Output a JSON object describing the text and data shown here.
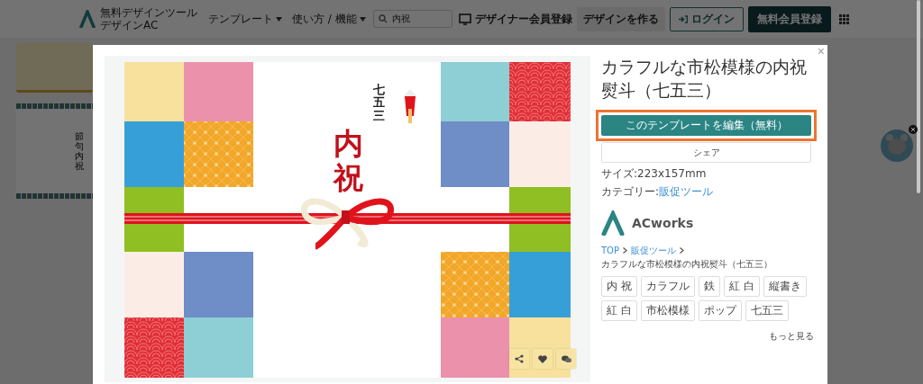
{
  "header": {
    "logo_lines": [
      "無料デザインツール",
      "デザインAC"
    ],
    "nav": [
      {
        "label": "テンプレート"
      },
      {
        "label": "使い方 / 機能"
      }
    ],
    "search": {
      "value": "内祝"
    },
    "designer_link": "デザイナー会員登録",
    "create_button": "デザインを作る",
    "login_button": "ログイン",
    "signup_button": "無料会員登録"
  },
  "background": {
    "thumbnail_text": "節句内祝"
  },
  "modal": {
    "close": "×",
    "template": {
      "subtitle": "七五三",
      "heading": "内祝"
    },
    "title": "カラフルな市松模様の内祝熨斗（七五三）",
    "edit_button": {
      "label": "このテンプレートを編集（無料）",
      "highlighted": true
    },
    "share_button": "シェア",
    "size": "サイズ:223x157mm",
    "category": {
      "label": "カテゴリー:",
      "link": "販促ツール"
    },
    "author": "ACworks",
    "breadcrumbs": [
      "TOP",
      "販促ツール",
      "カラフルな市松模様の内祝熨斗（七五三）"
    ],
    "tags": [
      "内 祝",
      "カラフル",
      "鉄",
      "紅 白",
      "縦書き",
      "紅 白",
      "市松模様",
      "ポップ",
      "七五三"
    ],
    "more_link": "もっと見る"
  }
}
